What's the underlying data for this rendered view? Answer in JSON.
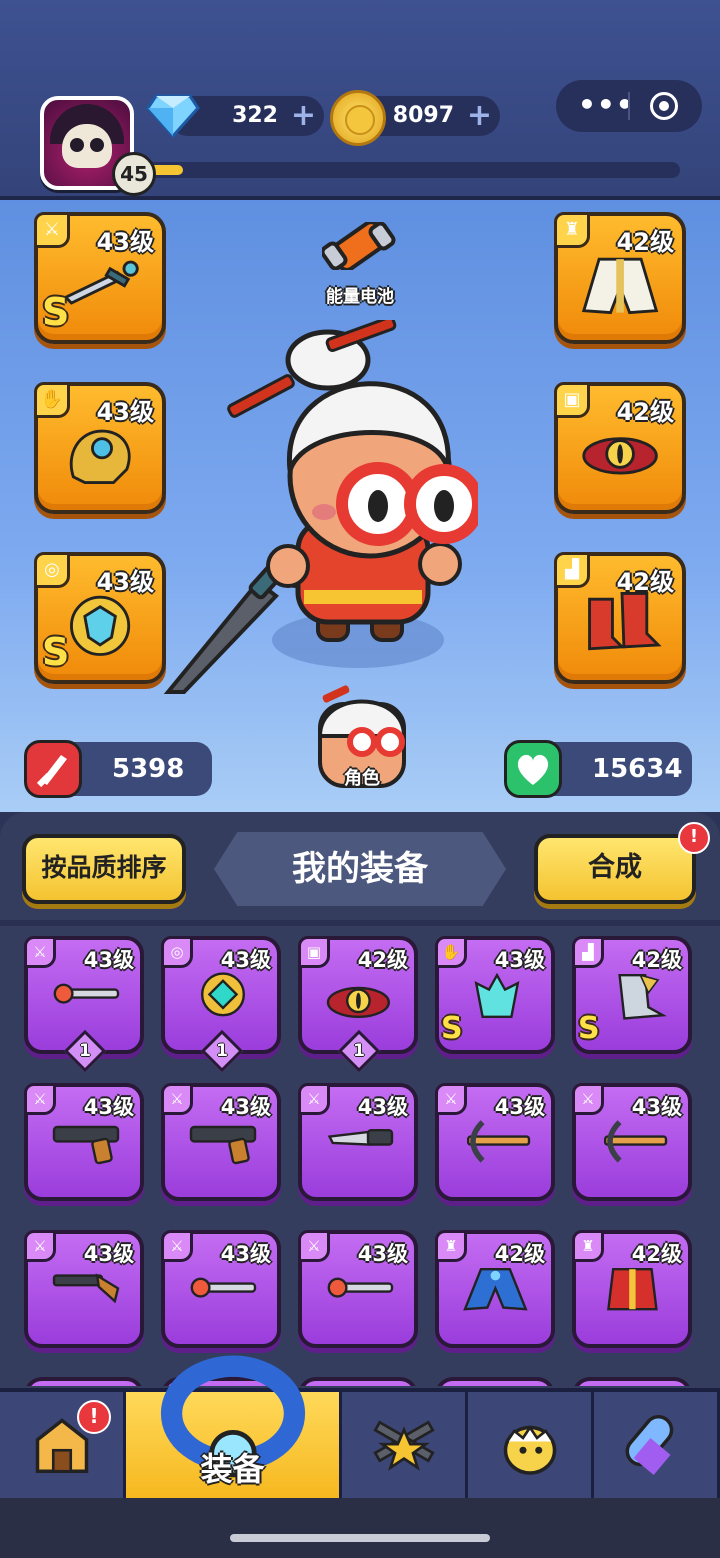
{
  "player": {
    "level": "45",
    "xp_fraction": 0.08
  },
  "currency": {
    "gems": "322",
    "coins": "8097"
  },
  "hero": {
    "battery_label": "能量电池",
    "role_label": "角色",
    "attack": "5398",
    "health": "15634"
  },
  "equipped": {
    "left": [
      {
        "type_icon": "weapon-icon",
        "level": "43级",
        "item": "sword",
        "badge": "S"
      },
      {
        "type_icon": "glove-icon",
        "level": "43级",
        "item": "gauntlet",
        "badge": ""
      },
      {
        "type_icon": "ring-icon",
        "level": "43级",
        "item": "shield-ring",
        "badge": "S"
      }
    ],
    "right": [
      {
        "type_icon": "armor-icon",
        "level": "42级",
        "item": "coat",
        "badge": ""
      },
      {
        "type_icon": "belt-icon",
        "level": "42级",
        "item": "eye-belt",
        "badge": ""
      },
      {
        "type_icon": "boots-icon",
        "level": "42级",
        "item": "red-boots",
        "badge": ""
      }
    ]
  },
  "inventory": {
    "sort_label": "按品质排序",
    "title": "我的装备",
    "merge_label": "合成",
    "merge_alert": "!",
    "items": [
      {
        "type_icon": "weapon-icon",
        "level": "43级",
        "item": "staff-orb",
        "badge": "",
        "count": "1"
      },
      {
        "type_icon": "ring-icon",
        "level": "43级",
        "item": "gold-ring",
        "badge": "",
        "count": "1"
      },
      {
        "type_icon": "belt-icon",
        "level": "42级",
        "item": "eye-belt",
        "badge": "",
        "count": "1"
      },
      {
        "type_icon": "glove-icon",
        "level": "43级",
        "item": "crystal-glove",
        "badge": "S",
        "count": ""
      },
      {
        "type_icon": "boots-icon",
        "level": "42级",
        "item": "armored-boot",
        "badge": "S",
        "count": ""
      },
      {
        "type_icon": "weapon-icon",
        "level": "43级",
        "item": "pistol",
        "badge": "",
        "count": ""
      },
      {
        "type_icon": "weapon-icon",
        "level": "43级",
        "item": "pistol",
        "badge": "",
        "count": ""
      },
      {
        "type_icon": "weapon-icon",
        "level": "43级",
        "item": "knife",
        "badge": "",
        "count": ""
      },
      {
        "type_icon": "weapon-icon",
        "level": "43级",
        "item": "crossbow",
        "badge": "",
        "count": ""
      },
      {
        "type_icon": "weapon-icon",
        "level": "43级",
        "item": "crossbow",
        "badge": "",
        "count": ""
      },
      {
        "type_icon": "weapon-icon",
        "level": "43级",
        "item": "shotgun",
        "badge": "",
        "count": ""
      },
      {
        "type_icon": "weapon-icon",
        "level": "43级",
        "item": "staff-orb",
        "badge": "",
        "count": ""
      },
      {
        "type_icon": "weapon-icon",
        "level": "43级",
        "item": "staff-orb",
        "badge": "",
        "count": ""
      },
      {
        "type_icon": "armor-icon",
        "level": "42级",
        "item": "blue-coat",
        "badge": "",
        "count": ""
      },
      {
        "type_icon": "armor-icon",
        "level": "42级",
        "item": "red-vest",
        "badge": "",
        "count": ""
      }
    ]
  },
  "nav": {
    "items": [
      {
        "icon": "shop-house-icon",
        "label": "",
        "alert": "!"
      },
      {
        "icon": "equipment-ring-icon",
        "label": "装备",
        "alert": ""
      },
      {
        "icon": "guns-star-icon",
        "label": "",
        "alert": ""
      },
      {
        "icon": "chick-egg-icon",
        "label": "",
        "alert": ""
      },
      {
        "icon": "capsule-icon",
        "label": "",
        "alert": ""
      }
    ],
    "active_index": 1
  },
  "colors": {
    "legendary_slot": "#f59c1a",
    "epic_card": "#b058e8",
    "accent_yellow": "#f4c331",
    "alert_red": "#e8383d"
  }
}
